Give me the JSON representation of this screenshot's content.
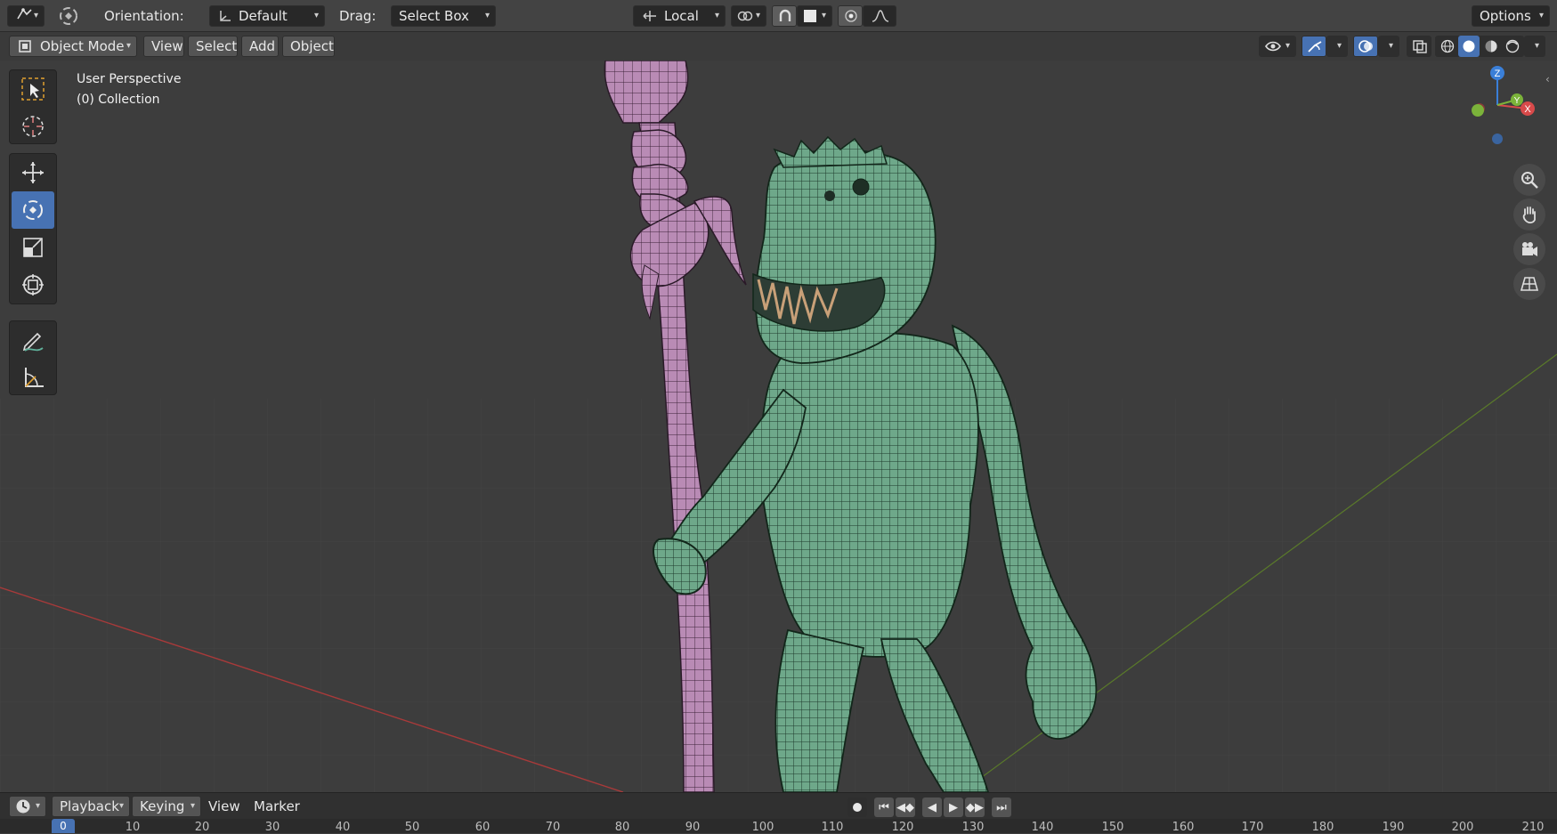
{
  "topbar": {
    "orientation_label": "Orientation:",
    "orientation_value": "Default",
    "drag_label": "Drag:",
    "drag_value": "Select Box",
    "pivot_value": "Local",
    "options_label": "Options"
  },
  "header": {
    "mode": "Object Mode",
    "menu": [
      "View",
      "Select",
      "Add",
      "Object"
    ]
  },
  "viewport": {
    "perspective": "User Perspective",
    "collection": "(0) Collection",
    "gizmo_axes": {
      "z": "Z",
      "y": "Y",
      "x": "X"
    }
  },
  "timeline": {
    "menu": [
      "Playback",
      "Keying",
      "View",
      "Marker"
    ],
    "current_frame": "0",
    "ticks": [
      "0",
      "10",
      "20",
      "30",
      "40",
      "50",
      "60",
      "70",
      "80",
      "90",
      "100",
      "110",
      "120",
      "130",
      "140",
      "150",
      "160",
      "170",
      "180",
      "190",
      "200",
      "210"
    ]
  },
  "colors": {
    "accent": "#4772b3",
    "creature_fill": "#6ea88a",
    "staff_fill": "#b98bb5",
    "x_axis": "#a83a3a",
    "y_axis": "#5a7a2a"
  },
  "icons": {
    "toolbar": [
      "select-box-icon",
      "cursor-icon",
      "move-icon",
      "rotate-icon",
      "scale-icon",
      "transform-icon",
      "annotate-icon",
      "measure-icon"
    ],
    "navigate": [
      "zoom-icon",
      "hand-icon",
      "camera-icon",
      "grid-icon"
    ]
  }
}
